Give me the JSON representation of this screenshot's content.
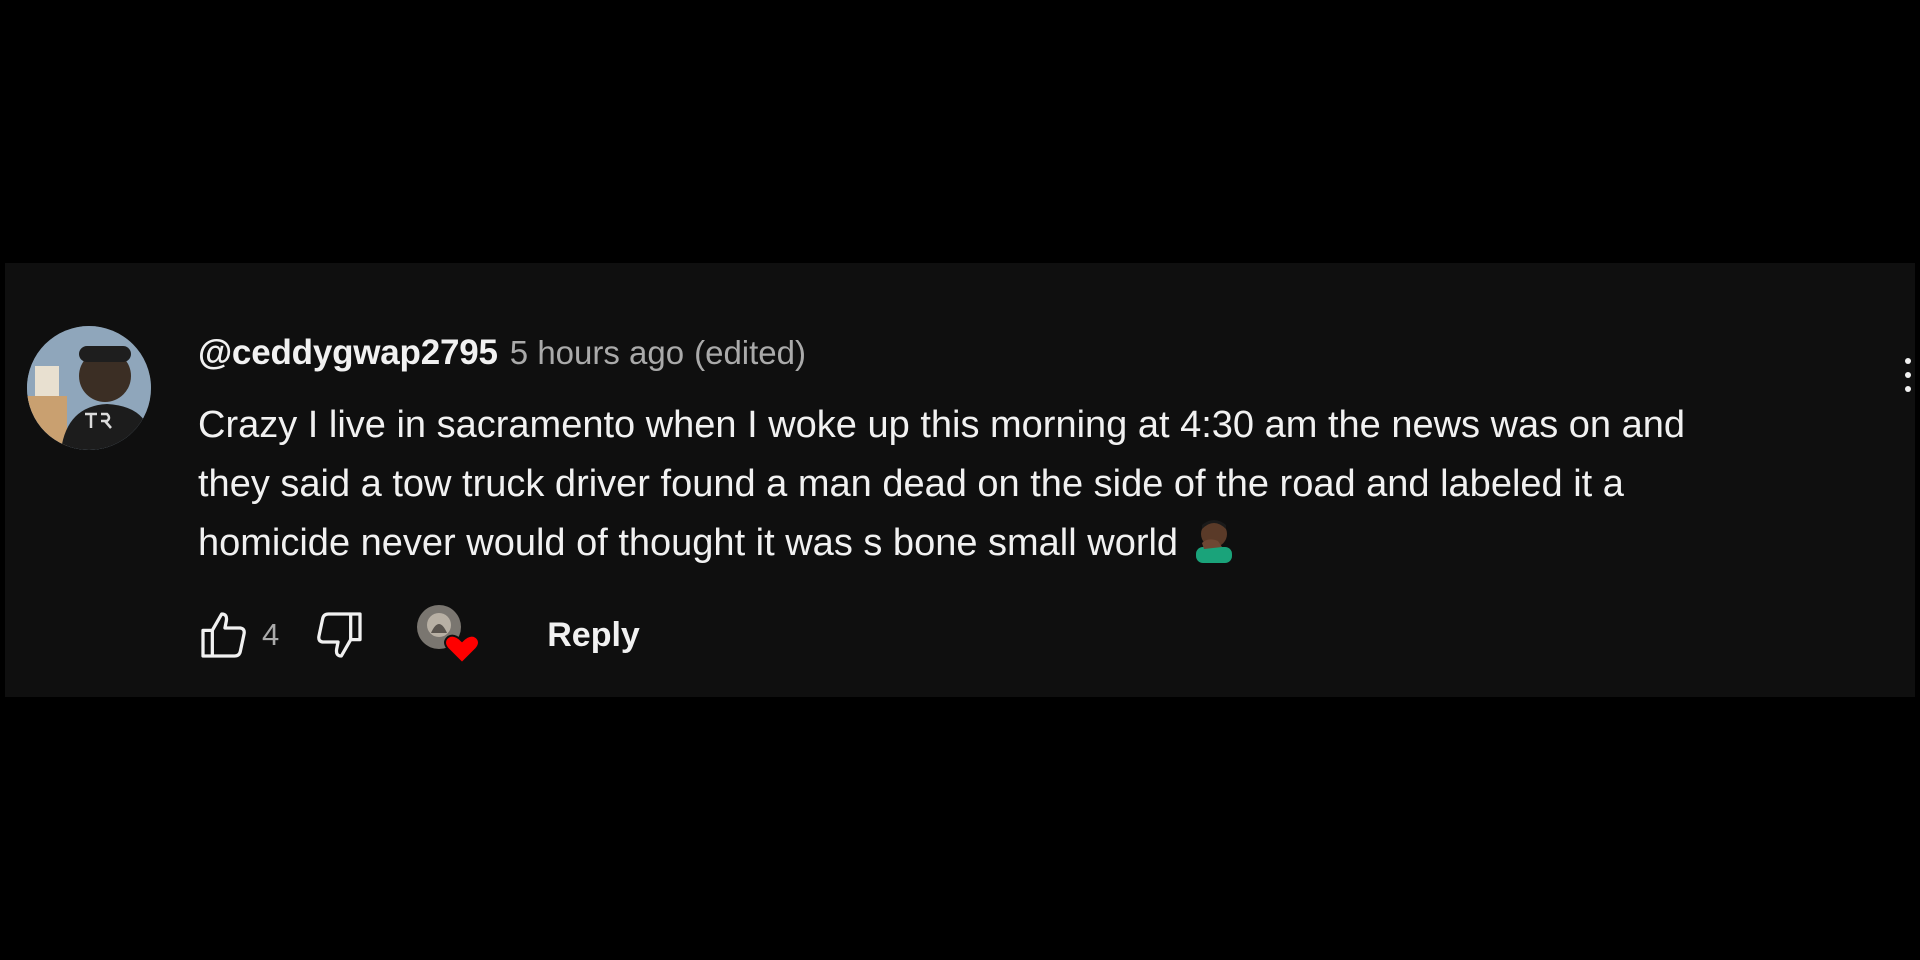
{
  "comment": {
    "author": "@ceddygwap2795",
    "time": "5 hours ago",
    "edited": "(edited)",
    "text_lines": [
      "Crazy I live in sacramento when I woke up this morning at 4:30 am the news was on and",
      "they said a tow truck driver found a man dead on the side of the road and labeled it a",
      "homicide never would of thought it was s bone small world"
    ],
    "emoji": "man-facepalming-emoji",
    "like_count": "4",
    "reply_label": "Reply"
  },
  "icons": {
    "like": "thumbs-up-icon",
    "dislike": "thumbs-down-icon",
    "heart": "creator-heart-icon",
    "more": "more-vertical-icon"
  },
  "colors": {
    "background": "#000000",
    "card": "#0f0f0f",
    "primary_text": "#f1f1f1",
    "secondary_text": "#aaaaaa",
    "heart": "#ff0000"
  }
}
